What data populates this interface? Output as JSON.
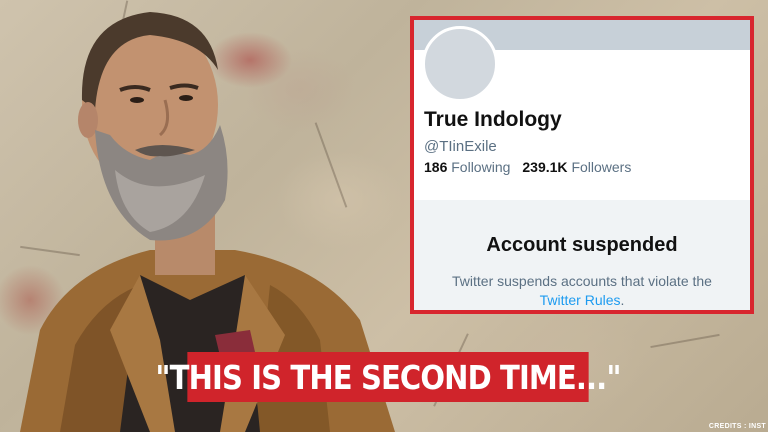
{
  "profile": {
    "name": "True Indology",
    "handle": "@TIinExile",
    "following_count": "186",
    "following_label": "Following",
    "followers_count": "239.1K",
    "followers_label": "Followers"
  },
  "suspension": {
    "title": "Account suspended",
    "message": "Twitter suspends accounts that violate the",
    "link_text": "Twitter Rules",
    "link_suffix": "."
  },
  "caption": {
    "text": "\"THIS IS THE SECOND TIME...\""
  },
  "credits": {
    "text": "CREDITS : INST"
  },
  "colors": {
    "accent_red": "#d0242b",
    "link_blue": "#1d9bf0",
    "muted_text": "#5b7083"
  }
}
